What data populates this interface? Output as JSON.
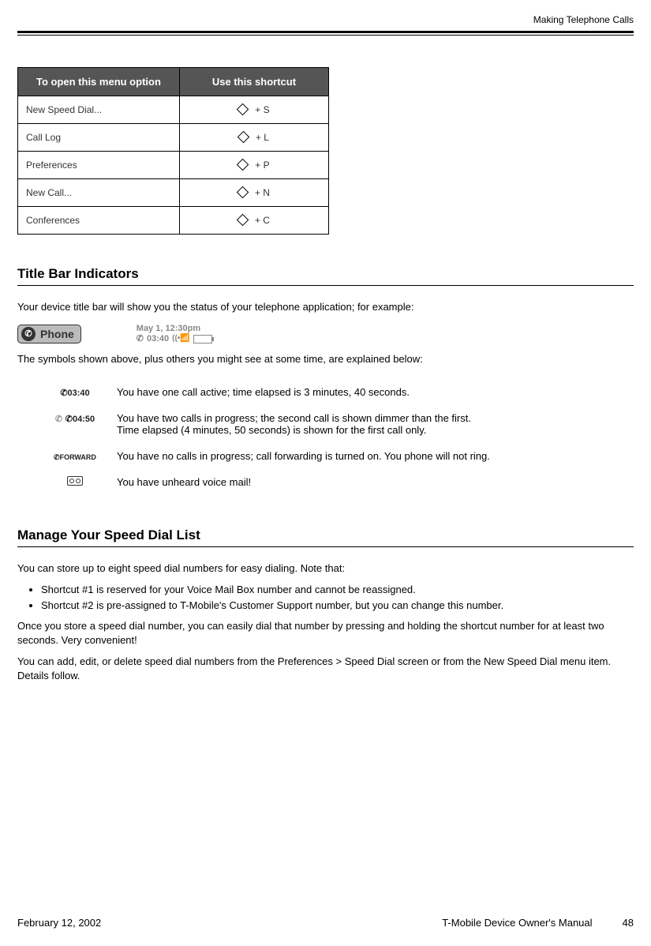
{
  "header": {
    "chapter": "Making Telephone Calls"
  },
  "table": {
    "headers": {
      "left": "To open this menu option",
      "right": "Use this shortcut"
    },
    "rows": [
      {
        "label": "New Speed Dial...",
        "key": "+ S"
      },
      {
        "label": "Call Log",
        "key": "+ L"
      },
      {
        "label": "Preferences",
        "key": "+ P"
      },
      {
        "label": "New Call...",
        "key": "+ N"
      },
      {
        "label": "Conferences",
        "key": "+ C"
      }
    ]
  },
  "section1": {
    "title": "Title Bar Indicators",
    "intro": "Your device title bar will show you the status of your telephone application; for example:",
    "capsule_label": "Phone",
    "status": {
      "datetime": "May 1, 12:30pm",
      "timer": "03:40"
    },
    "after": "The symbols shown above, plus others you might see at some time, are explained below:"
  },
  "explain": {
    "r1": {
      "icon": "03:40",
      "text": "You have one call active; time elapsed is 3 minutes, 40 seconds."
    },
    "r2": {
      "icon": "04:50",
      "text1": "You have two calls in progress; the second call is shown dimmer than the first.",
      "text2": "Time elapsed (4 minutes, 50 seconds) is shown for the first call only."
    },
    "r3": {
      "icon": "FORWARD",
      "text": "You have no calls in progress; call forwarding is turned on. You phone will not ring."
    },
    "r4": {
      "text": "You have unheard voice mail!"
    }
  },
  "section2": {
    "title": "Manage Your Speed Dial List",
    "intro": "You can store up to eight speed dial numbers for easy dialing. Note that:",
    "bul1": "Shortcut #1 is reserved for your Voice Mail Box number and cannot be reassigned.",
    "bul2": "Shortcut #2 is pre-assigned to T-Mobile's Customer Support number, but you can change this number.",
    "p1": "Once you store a speed dial number, you can easily dial that number by pressing and holding the shortcut number for at least two seconds. Very convenient!",
    "p2": "You can add, edit, or delete speed dial numbers from the Preferences > Speed Dial screen or from the New Speed Dial menu item. Details follow."
  },
  "footer": {
    "date": "February 12, 2002",
    "title": "T-Mobile Device Owner's Manual",
    "page": "48"
  }
}
